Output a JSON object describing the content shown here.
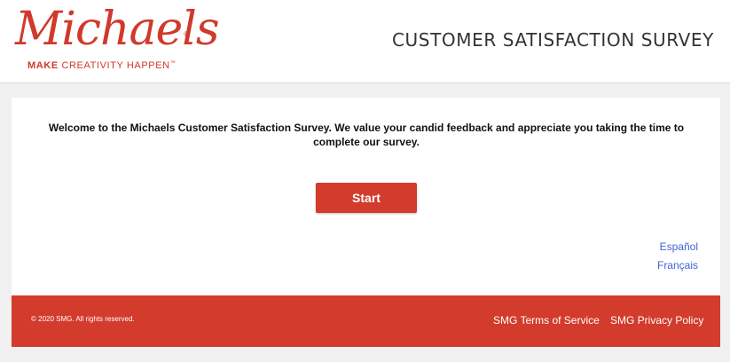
{
  "header": {
    "logo_text": "Michaels",
    "logo_tm": "®",
    "tagline_bold": "MAKE",
    "tagline_rest": " CREATIVITY HAPPEN",
    "tagline_tm": "™",
    "title": "CUSTOMER SATISFACTION SURVEY"
  },
  "main": {
    "welcome_text": "Welcome to the Michaels Customer Satisfaction Survey. We value your candid feedback and appreciate you taking the time to complete our survey.",
    "start_label": "Start",
    "languages": [
      "Español",
      "Français"
    ]
  },
  "footer": {
    "copyright": "© 2020 SMG. All rights reserved.",
    "terms_label": "SMG Terms of Service",
    "privacy_label": "SMG Privacy Policy"
  },
  "colors": {
    "brand_red": "#d33b2c",
    "link_blue": "#3f63d6",
    "page_bg": "#f0f0f0"
  }
}
